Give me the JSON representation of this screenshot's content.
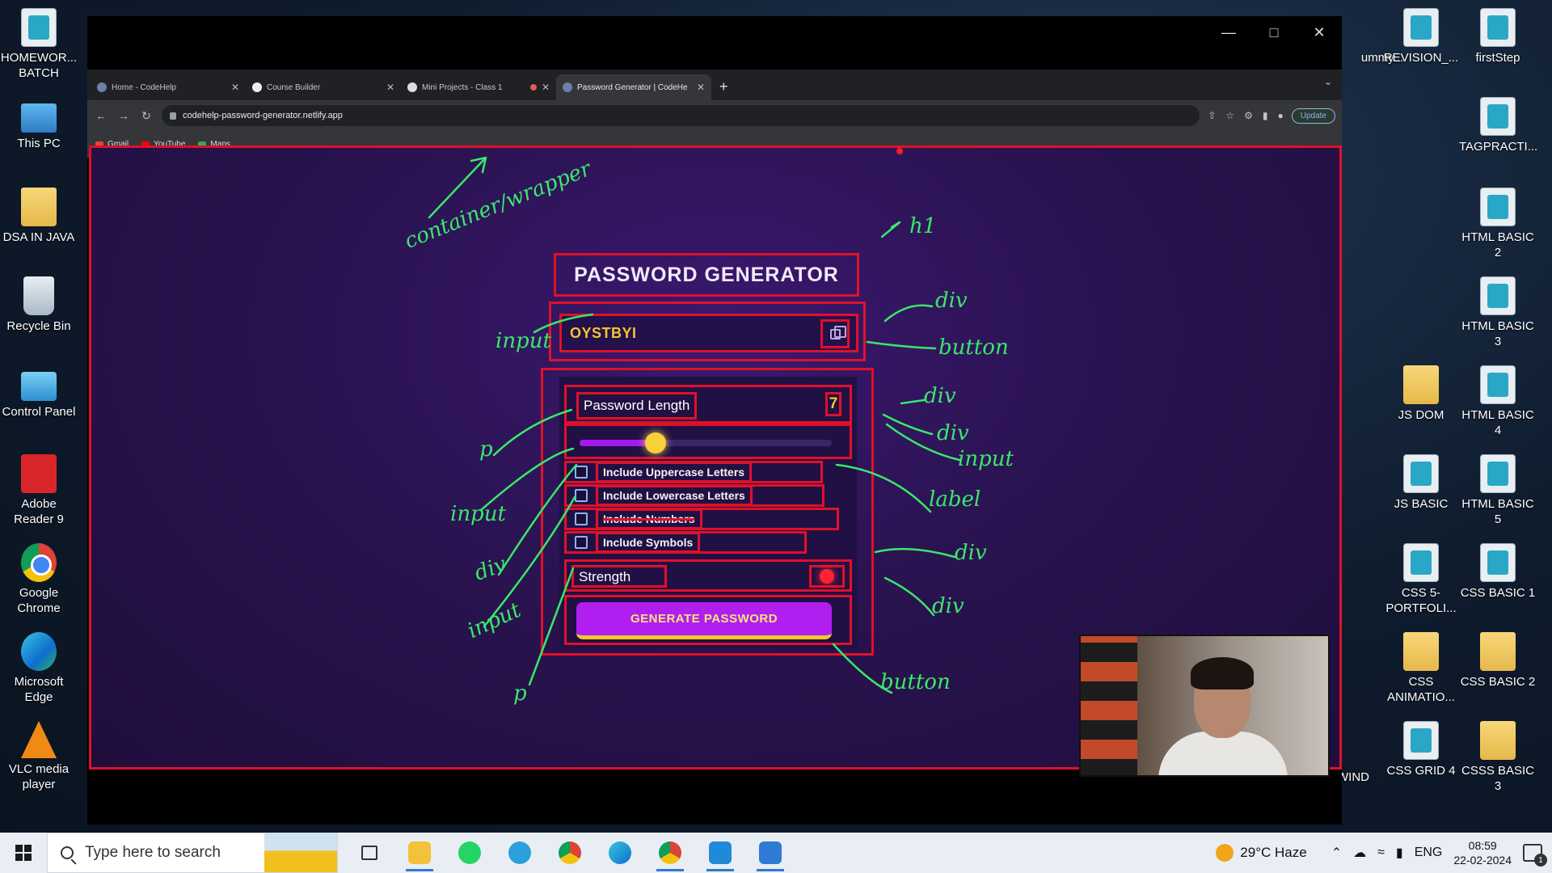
{
  "desktop": {
    "left_icons": [
      {
        "label": "HOMEWOR... BATCH",
        "icon": "document-icon"
      },
      {
        "label": "This PC",
        "icon": "computer-icon"
      },
      {
        "label": "DSA IN JAVA",
        "icon": "folder-icon"
      },
      {
        "label": "Recycle Bin",
        "icon": "recycle-bin-icon"
      },
      {
        "label": "Control Panel",
        "icon": "control-panel-icon"
      },
      {
        "label": "Adobe Reader 9",
        "icon": "pdf-icon"
      },
      {
        "label": "Google Chrome",
        "icon": "chrome-icon"
      },
      {
        "label": "Microsoft Edge",
        "icon": "edge-icon"
      },
      {
        "label": "VLC media player",
        "icon": "vlc-icon"
      }
    ],
    "right_icons": [
      {
        "label": "REVISION_...",
        "icon": "document-icon"
      },
      {
        "label": "firstStep",
        "icon": "document-icon"
      },
      {
        "label": "TAGPRACTI...",
        "icon": "document-icon"
      },
      {
        "label": "HTML BASIC 2",
        "icon": "document-icon"
      },
      {
        "label": "HTML BASIC 3",
        "icon": "document-icon"
      },
      {
        "label": "JS DOM",
        "icon": "folder-icon"
      },
      {
        "label": "HTML BASIC 4",
        "icon": "document-icon"
      },
      {
        "label": "JS BASIC",
        "icon": "document-icon"
      },
      {
        "label": "HTML BASIC 5",
        "icon": "document-icon"
      },
      {
        "label": "CSS 5-PORTFOLI...",
        "icon": "document-icon"
      },
      {
        "label": "CSS BASIC 1",
        "icon": "document-icon"
      },
      {
        "label": "CSS ANIMATIO...",
        "icon": "folder-icon"
      },
      {
        "label": "CSS BASIC 2",
        "icon": "folder-icon"
      },
      {
        "label": "CSS GRID 4",
        "icon": "document-icon"
      },
      {
        "label": "CSSS BASIC 3",
        "icon": "folder-icon"
      }
    ],
    "partial_labels": [
      "ummy...",
      "WIND"
    ]
  },
  "browser": {
    "tabs": [
      {
        "label": "Home - CodeHelp",
        "active": false
      },
      {
        "label": "Course Builder",
        "active": false
      },
      {
        "label": "Mini Projects - Class 1",
        "active": false
      },
      {
        "label": "Password Generator | CodeHe",
        "active": true
      }
    ],
    "new_tab": "+",
    "url": "codehelp-password-generator.netlify.app",
    "update_button": "Update",
    "bookmarks": [
      "Gmail",
      "YouTube",
      "Maps"
    ]
  },
  "app": {
    "title": "PASSWORD GENERATOR",
    "password": "OYSTBYI",
    "length_label": "Password Length",
    "length_value": "7",
    "slider_fraction": 0.3,
    "options": [
      {
        "label": "Include Uppercase Letters",
        "checked": false
      },
      {
        "label": "Include Lowercase Letters",
        "checked": false
      },
      {
        "label": "Include Numbers",
        "checked": false
      },
      {
        "label": "Include Symbols",
        "checked": false
      }
    ],
    "strength_label": "Strength",
    "strength_color": "#ff2233",
    "generate_label": "GENERATE PASSWORD"
  },
  "annotations": {
    "wrapper": "container/wrapper",
    "h1": "h1",
    "div1": "div",
    "input1": "input",
    "button1": "button",
    "div2": "div",
    "div3": "div",
    "p1": "p",
    "input2": "input",
    "input3": "input",
    "label": "label",
    "div4": "div",
    "div5": "div",
    "input4": "input",
    "div6": "div",
    "p2": "p",
    "button2": "button"
  },
  "taskbar": {
    "search_placeholder": "Type here to search",
    "weather": "29°C  Haze",
    "language": "ENG",
    "time": "08:59",
    "date": "22-02-2024",
    "notifications": "1"
  },
  "colors": {
    "annotation_border": "#e0102a",
    "accent_purple": "#b01ff0",
    "accent_yellow": "#f4c62c",
    "annotation_ink": "#39e86a"
  }
}
